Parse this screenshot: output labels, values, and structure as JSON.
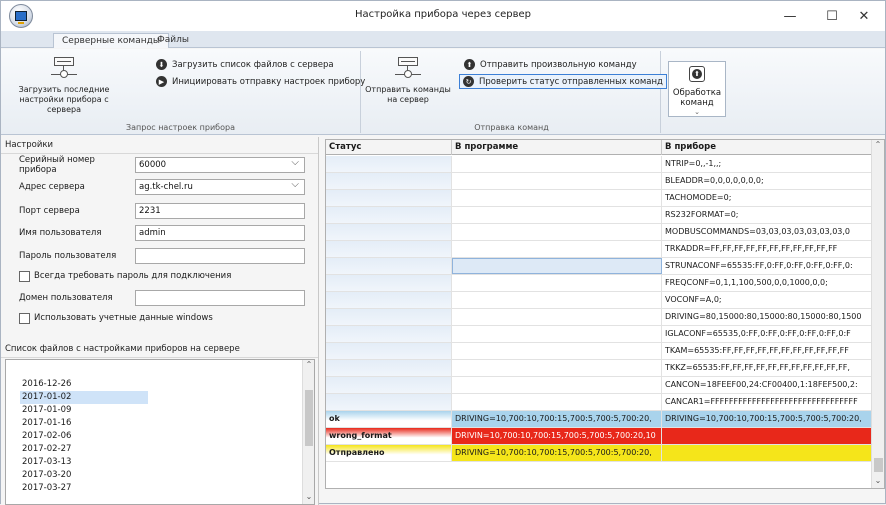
{
  "window": {
    "title": "Настройка прибора через сервер",
    "minimize": "—",
    "maximize": "☐",
    "close": "✕"
  },
  "tabs": [
    "Серверные команды",
    "Файлы"
  ],
  "ribbon": {
    "group1": {
      "label": "Запрос настроек прибора",
      "load_last": "Загрузить последние настройки прибора с сервера",
      "load_list": "Загрузить список файлов с сервера",
      "init_send": "Инициировать отправку настроек прибору"
    },
    "group2": {
      "label": "Отправка команд",
      "send_commands": "Отправить команды на сервер",
      "send_custom": "Отправить произвольную команду",
      "check_status": "Проверить статус отправленных команд"
    },
    "processing": "Обработка команд"
  },
  "settings": {
    "header": "Настройки",
    "serial_label": "Серийный номер прибора",
    "serial_value": "60000",
    "server_label": "Адрес сервера",
    "server_value": "ag.tk-chel.ru",
    "port_label": "Порт сервера",
    "port_value": "2231",
    "user_label": "Имя пользователя",
    "user_value": "admin",
    "password_label": "Пароль пользователя",
    "password_value": "",
    "always_password": "Всегда требовать пароль для подключения",
    "domain_label": "Домен пользователя",
    "domain_value": "",
    "use_windows": "Использовать учетные данные windows"
  },
  "files": {
    "header": "Список файлов с настройками приборов на сервере",
    "items": [
      "2016-12-26",
      "2017-01-02",
      "2017-01-09",
      "2017-01-16",
      "2017-02-06",
      "2017-02-27",
      "2017-03-13",
      "2017-03-20",
      "2017-03-27"
    ],
    "selected_index": 1
  },
  "grid": {
    "columns": [
      "Статус",
      "В программе",
      "В приборе"
    ],
    "rows": [
      [
        "",
        "",
        "NTRIP=0,,-1,,;"
      ],
      [
        "",
        "",
        "BLEADDR=0,0,0,0,0,0,0;"
      ],
      [
        "",
        "",
        "TACHOMODE=0;"
      ],
      [
        "",
        "",
        "RS232FORMAT=0;"
      ],
      [
        "",
        "",
        "MODBUSCOMMANDS=03,03,03,03,03,03,03,0"
      ],
      [
        "",
        "",
        "TRKADDR=FF,FF,FF,FF,FF,FF,FF,FF,FF,FF,FF"
      ],
      [
        "",
        "",
        "STRUNACONF=65535:FF,0:FF,0:FF,0:FF,0:FF,0:"
      ],
      [
        "",
        "",
        "FREQCONF=0,1,1,100,500,0,0,1000,0,0;"
      ],
      [
        "",
        "",
        "VOCONF=A,0;"
      ],
      [
        "",
        "",
        "DRIVING=80,15000:80,15000:80,15000:80,1500"
      ],
      [
        "",
        "",
        "IGLACONF=65535,0:FF,0:FF,0:FF,0:FF,0:FF,0:F"
      ],
      [
        "",
        "",
        "TKAM=65535:FF,FF,FF,FF,FF,FF,FF,FF,FF,FF,FF"
      ],
      [
        "",
        "",
        "TKKZ=65535:FF,FF,FF,FF,FF,FF,FF,FF,FF,FF,FF,"
      ],
      [
        "",
        "",
        "CANCON=18FEEF00,24:CF00400,1:18FEF500,2:"
      ],
      [
        "",
        "",
        "CANCAR1=FFFFFFFFFFFFFFFFFFFFFFFFFFFFFFFF"
      ],
      [
        "ok",
        "DRIVING=10,700:10,700:15,700:5,700:5,700:20,",
        "DRIVING=10,700:10,700:15,700:5,700:5,700:20,"
      ],
      [
        "wrong_format",
        "DRIVIN=10,700:10,700:15,700:5,700:5,700:20,10",
        ""
      ],
      [
        "Отправлено",
        "DRIVING=10,700:10,700:15,700:5,700:5,700:20,",
        ""
      ]
    ],
    "status_colors": {
      "ok": "#a9d3ec",
      "wrong_format": "#e8281a",
      "Отправлено": "#f5e51a"
    }
  },
  "colors": {
    "accent": "#3c7fd6",
    "ok_row": "#a9d3ec",
    "error_row": "#e8281a",
    "sent_row": "#f5e51a"
  }
}
